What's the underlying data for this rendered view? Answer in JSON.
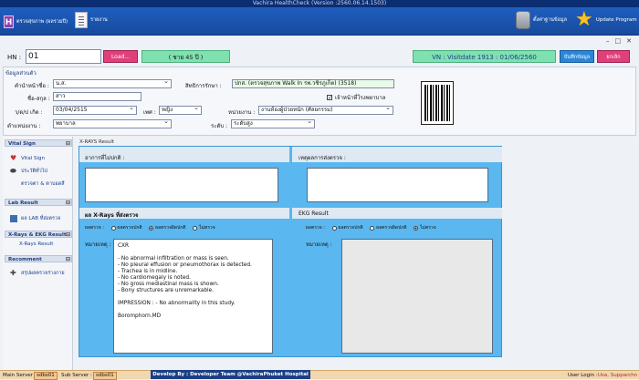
{
  "window": {
    "title": "Vachira HealthCheck  (Version :2560.06.14.1503)"
  },
  "ribbon": {
    "app_label": "ตรวจสุขภาพ (ผลรวมปี)",
    "report_label": "รายงาน",
    "db_label": "ตั้งค่าฐานข้อมูล",
    "update_label": "Update Program"
  },
  "header": {
    "hn_label": "HN :",
    "hn_value": "01",
    "load_label": "Load...",
    "age_text": "( ชาย 45 ปี )",
    "visit_text": "VN : Visitdate 1913 : 01/06/2560",
    "save_label": "บันทึกข้อมูล",
    "cancel_label": "ยกเลิก"
  },
  "patient": {
    "section_title": "ข้อมูลส่วนตัว",
    "prefix_label": "คำนำหน้าชื่อ :",
    "prefix_value": "น.ส.",
    "name_label": "ชื่อ-สกุล :",
    "name_value": "สาว",
    "dob_label": "ว/ด/ป เกิด :",
    "dob_value": "03/04/2515",
    "sex_label": "เพศ :",
    "sex_value": "หญิง",
    "rights_label": "สิทธิการรักษา :",
    "rights_value": "ปกส. (ตรวจสุขภาพ Walk In รพ.วชิรภูเก็ต) (3518)",
    "self_pay_label": "เจ้าหน้าที่โรงพยาบาล",
    "unit_label": "หน่วยงาน :",
    "unit_value": "งานห้องผู้ป่วยหนัก (ศัลยกรรม)",
    "position_label": "ตำแหน่งงาน :",
    "position_value": "พยาบาล",
    "level_label": "ระดับ :",
    "level_value": "ระดับสูง"
  },
  "sidebar": {
    "vital_header": "Vital Sign",
    "vital_items": [
      "Vital Sign",
      "ประวัติทั่วไป",
      "ตรวจตา & ตาบอดสี"
    ],
    "lab_header": "Lab Result",
    "lab_items": [
      "ผล LAB ที่ส่งตรวจ"
    ],
    "xray_header": "X-Rays & EKG Result",
    "xray_items": [
      "X-Rays Result"
    ],
    "recommend_header": "Recomment",
    "recommend_items": [
      "สรุปผลตรวจร่างกาย"
    ]
  },
  "xray": {
    "panel_title": "X-RAYS Result",
    "history_label": "อาการที่ไม่ปกติ :",
    "extra_label": "เหตุผลการส่งตรวจ :",
    "xray_title": "ผล X-Rays ที่ส่งตรวจ",
    "xray_result_label": "ผลตรวจ :",
    "radio_normal": "ผลตรวจปกติ",
    "radio_abnormal": "ผลตรวจผิดปกติ",
    "radio_none": "ไม่ตรวจ",
    "xray_note_label": "หมายเหตุ :",
    "xray_report": "CXR\n\n- No abnormal infiltration or mass is seen.\n- No pleural effusion or pneumothorax is detected.\n- Trachea is in midline.\n- No cardiomegaly is noted.\n- No gross mediastinal mass is shown.\n- Bony structures are unremarkable.\n\nIMPRESSION : - No abnormality in this study.\n\nBoromphorn.MD",
    "ekg_title": "EKG Result",
    "ekg_result_label": "ผลตรวจ :",
    "ekg_note_label": "หมายเหตุ :"
  },
  "status": {
    "main_server_label": "Main Server :",
    "main_server_value": "sdbs01",
    "sub_server_label": "Sub Server :",
    "sub_server_value": "sdbs01",
    "center_text": "Develop By : Developer Team  @VachiraPhuket Hospital",
    "user_label": "User Login :",
    "user_value": "Usa, Supparchn"
  }
}
